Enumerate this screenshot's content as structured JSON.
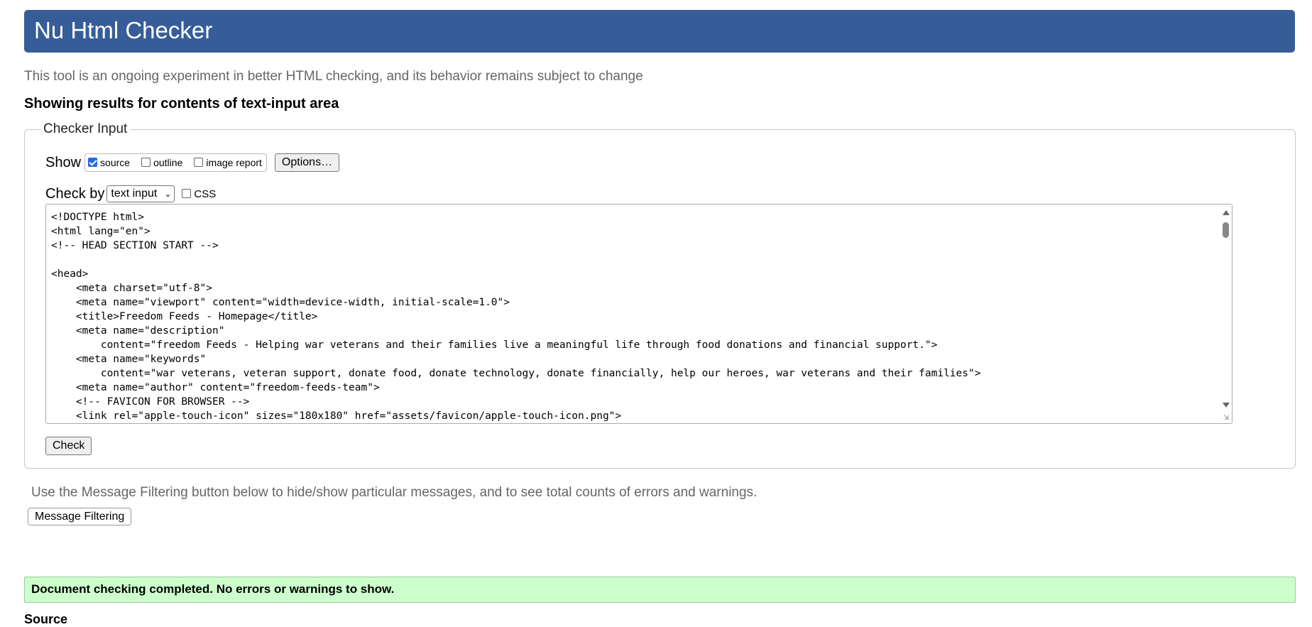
{
  "header": {
    "title": "Nu Html Checker"
  },
  "tagline": "This tool is an ongoing experiment in better HTML checking, and its behavior remains subject to change",
  "showing_heading": "Showing results for contents of text-input area",
  "checker_input": {
    "legend": "Checker Input",
    "show_label": "Show",
    "show_options": [
      {
        "label": "source",
        "checked": true
      },
      {
        "label": "outline",
        "checked": false
      },
      {
        "label": "image report",
        "checked": false
      }
    ],
    "options_button": "Options…",
    "check_by_label": "Check by",
    "check_by_selected": "text input",
    "css_label": "CSS",
    "source_text": "<!DOCTYPE html>\n<html lang=\"en\">\n<!-- HEAD SECTION START -->\n\n<head>\n    <meta charset=\"utf-8\">\n    <meta name=\"viewport\" content=\"width=device-width, initial-scale=1.0\">\n    <title>Freedom Feeds - Homepage</title>\n    <meta name=\"description\"\n        content=\"freedom Feeds - Helping war veterans and their families live a meaningful life through food donations and financial support.\">\n    <meta name=\"keywords\"\n        content=\"war veterans, veteran support, donate food, donate technology, donate financially, help our heroes, war veterans and their families\">\n    <meta name=\"author\" content=\"freedom-feeds-team\">\n    <!-- FAVICON FOR BROWSER -->\n    <link rel=\"apple-touch-icon\" sizes=\"180x180\" href=\"assets/favicon/apple-touch-icon.png\">",
    "check_button": "Check"
  },
  "filter_note": "Use the Message Filtering button below to hide/show particular messages, and to see total counts of errors and warnings.",
  "filter_button": "Message Filtering",
  "result_message": "Document checking completed. No errors or warnings to show.",
  "source_heading": "Source",
  "colors": {
    "header_bg": "#365d98",
    "success_bg": "#ccffcc",
    "checkbox_checked": "#2568d9"
  }
}
